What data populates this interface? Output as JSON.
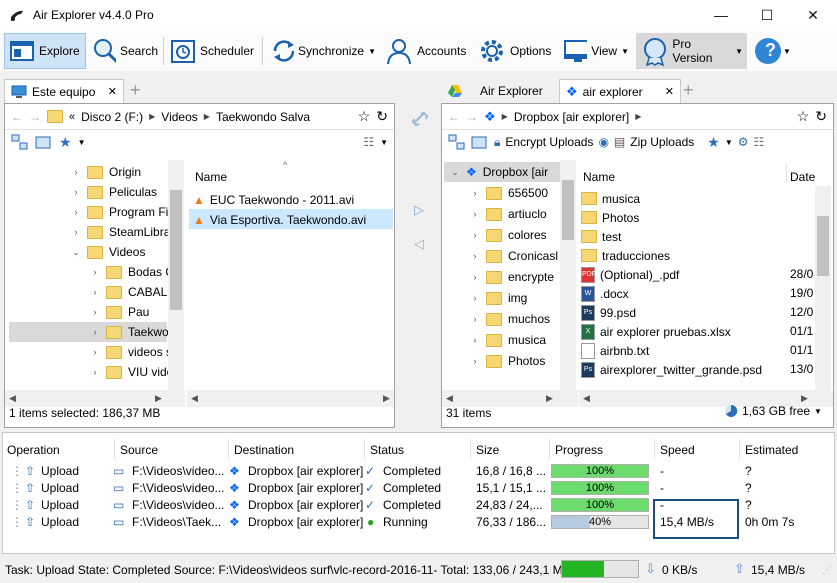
{
  "window": {
    "title": "Air Explorer v4.4.0 Pro",
    "minimize": "—",
    "maximize": "☐",
    "close": "✕"
  },
  "toolbar": {
    "explore": "Explore",
    "search": "Search",
    "scheduler": "Scheduler",
    "synchronize": "Synchronize",
    "accounts": "Accounts",
    "options": "Options",
    "view": "View",
    "pro_version": "Pro Version",
    "help": "?"
  },
  "left": {
    "tab": "Este equipo",
    "breadcrumb": [
      "Disco 2 (F:)",
      "Videos",
      "Taekwondo Salva"
    ],
    "tree": [
      "Origin",
      "Peliculas",
      "Program Fi",
      "SteamLibra",
      "Videos",
      "Bodas C",
      "CABALL",
      "Pau",
      "Taekwo",
      "videos s",
      "VIU vide"
    ],
    "column_name": "Name",
    "files": [
      "EUC Taekwondo - 2011.avi",
      "Via Esportiva. Taekwondo.avi"
    ],
    "status": "1 items selected: 186,37 MB"
  },
  "right": {
    "tab_inactive": "Air Explorer",
    "tab_active": "air explorer",
    "breadcrumb": [
      "Dropbox [air explorer]"
    ],
    "encrypt_uploads": "Encrypt Uploads",
    "zip_uploads": "Zip Uploads",
    "tree_root": "Dropbox [air",
    "tree": [
      "656500",
      "artiuclo",
      "colores",
      "Cronicasl",
      "encrypte",
      "img",
      "muchos",
      "musica",
      "Photos"
    ],
    "column_name": "Name",
    "column_date": "Date",
    "files": [
      {
        "name": "musica",
        "date": "",
        "type": "folder"
      },
      {
        "name": "Photos",
        "date": "",
        "type": "folder"
      },
      {
        "name": "test",
        "date": "",
        "type": "folder"
      },
      {
        "name": "traducciones",
        "date": "",
        "type": "folder"
      },
      {
        "name": "(Optional)_.pdf",
        "date": "28/0",
        "type": "pdf"
      },
      {
        "name": ".docx",
        "date": "19/0",
        "type": "docx"
      },
      {
        "name": "99.psd",
        "date": "12/0",
        "type": "psd"
      },
      {
        "name": "air explorer pruebas.xlsx",
        "date": "01/1",
        "type": "xlsx"
      },
      {
        "name": "airbnb.txt",
        "date": "01/1",
        "type": "txt"
      },
      {
        "name": "airexplorer_twitter_grande.psd",
        "date": "13/0",
        "type": "psd"
      }
    ],
    "status_items": "31 items",
    "free_space": "1,63 GB free"
  },
  "transfers": {
    "headers": [
      "Operation",
      "Source",
      "Destination",
      "Status",
      "Size",
      "Progress",
      "Speed",
      "Estimated"
    ],
    "rows": [
      {
        "operation": "Upload",
        "source": "F:\\Videos\\video...",
        "destination": "Dropbox [air explorer]",
        "status": "Completed",
        "size": "16,8 / 16,8 ...",
        "progress": 100,
        "progress_label": "100%",
        "speed": "-",
        "estimated": "?"
      },
      {
        "operation": "Upload",
        "source": "F:\\Videos\\video...",
        "destination": "Dropbox [air explorer]",
        "status": "Completed",
        "size": "15,1 / 15,1 ...",
        "progress": 100,
        "progress_label": "100%",
        "speed": "-",
        "estimated": "?"
      },
      {
        "operation": "Upload",
        "source": "F:\\Videos\\video...",
        "destination": "Dropbox [air explorer]",
        "status": "Completed",
        "size": "24,83 / 24,...",
        "progress": 100,
        "progress_label": "100%",
        "speed": "-",
        "estimated": "?"
      },
      {
        "operation": "Upload",
        "source": "F:\\Videos\\Taek...",
        "destination": "Dropbox [air explorer]",
        "status": "Running",
        "size": "76,33 / 186...",
        "progress": 40,
        "progress_label": "40%",
        "speed": "15,4 MB/s",
        "estimated": "0h 0m 7s"
      }
    ]
  },
  "task": {
    "text": "Task: Upload State: Completed Source: F:\\Videos\\videos surf\\vlc-record-2016-11- Total: 133,06 / 243,1 MB",
    "progress": 55,
    "down_speed": "0 KB/s",
    "up_speed": "15,4 MB/s"
  },
  "colors": {
    "accent": "#0063b1",
    "progress_green": "#6bdc6b",
    "progress_blue": "#b7cbe0",
    "folder": "#f7d774",
    "highlight": "#cce8ff",
    "selection": "#d9d9d9",
    "speed_box": "#1b4e7a"
  }
}
